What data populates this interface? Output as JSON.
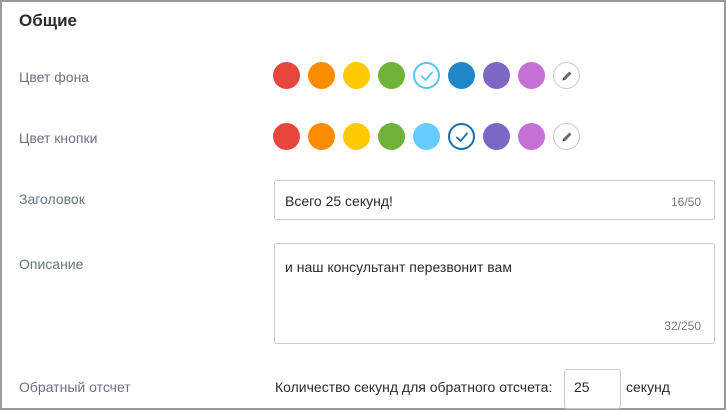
{
  "section": {
    "title": "Общие"
  },
  "background_color": {
    "label": "Цвет фона",
    "swatches": [
      {
        "name": "red",
        "color": "#e8453c"
      },
      {
        "name": "orange",
        "color": "#fb8c00"
      },
      {
        "name": "yellow",
        "color": "#fdc900"
      },
      {
        "name": "green",
        "color": "#6fb33a"
      },
      {
        "name": "light-blue",
        "color": "#55c6f2",
        "selected": true
      },
      {
        "name": "blue",
        "color": "#1f87c9"
      },
      {
        "name": "purple",
        "color": "#7e66c6"
      },
      {
        "name": "violet",
        "color": "#c570d3"
      }
    ]
  },
  "button_color": {
    "label": "Цвет кнопки",
    "swatches": [
      {
        "name": "red",
        "color": "#e8453c"
      },
      {
        "name": "orange",
        "color": "#fb8c00"
      },
      {
        "name": "yellow",
        "color": "#fdc900"
      },
      {
        "name": "green",
        "color": "#6fb33a"
      },
      {
        "name": "light-blue",
        "color": "#66ccff"
      },
      {
        "name": "blue",
        "color": "#1a6fa8",
        "selected": true
      },
      {
        "name": "purple",
        "color": "#7e66c6"
      },
      {
        "name": "violet",
        "color": "#c570d3"
      }
    ]
  },
  "icons": {
    "selected": "check-icon",
    "custom": "pencil-icon"
  },
  "title_field": {
    "label": "Заголовок",
    "value": "Всего 25 секунд!",
    "counter": "16/50"
  },
  "description_field": {
    "label": "Описание",
    "value": "и наш консультант перезвонит вам",
    "counter": "32/250"
  },
  "countdown": {
    "label": "Обратный отсчет",
    "prompt": "Количество секунд для обратного отсчета:",
    "value": "25",
    "unit": "секунд"
  }
}
